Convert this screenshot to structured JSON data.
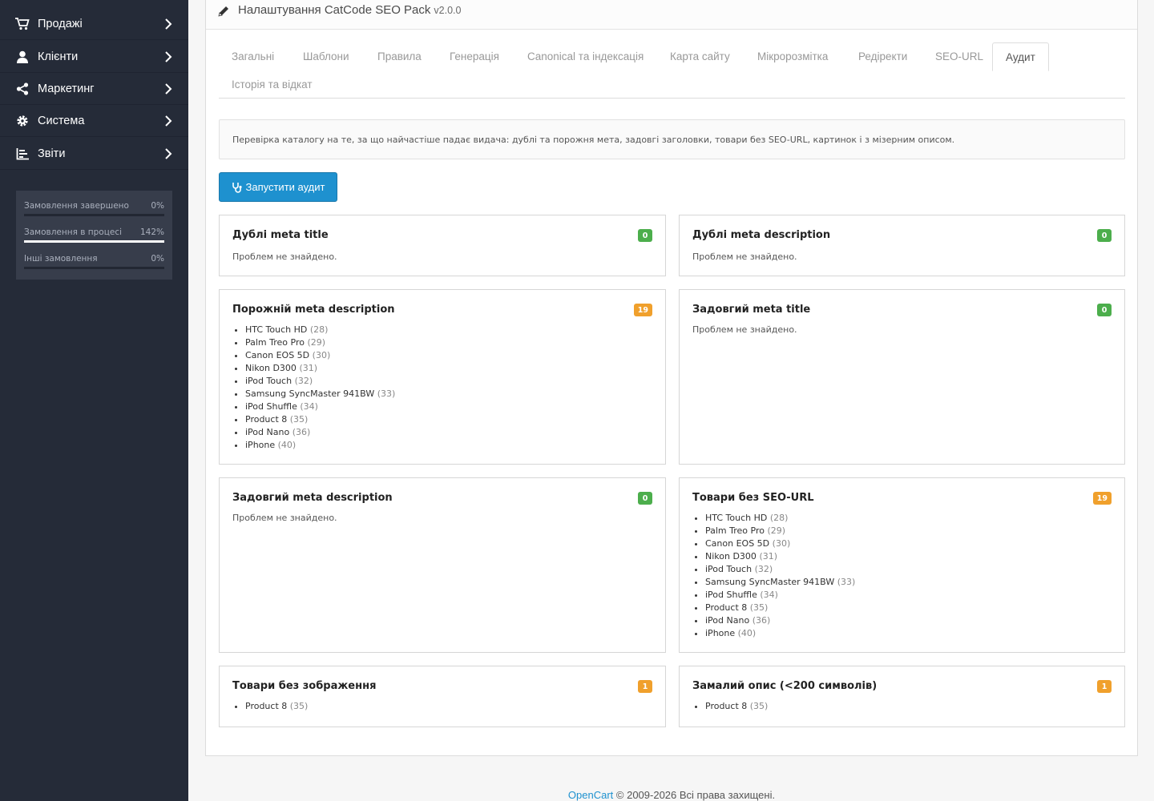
{
  "sidebar": {
    "items": [
      {
        "label": "Продажі",
        "icon": "cart-icon"
      },
      {
        "label": "Клієнти",
        "icon": "user-icon"
      },
      {
        "label": "Маркетинг",
        "icon": "share-icon"
      },
      {
        "label": "Система",
        "icon": "gear-icon"
      },
      {
        "label": "Звіти",
        "icon": "bar-chart-icon"
      }
    ],
    "stats": [
      {
        "label": "Замовлення завершено",
        "value": "0%",
        "fill": 0
      },
      {
        "label": "Замовлення в процесі",
        "value": "142%",
        "fill": 1
      },
      {
        "label": "Інші замовлення",
        "value": "0%",
        "fill": 0
      }
    ]
  },
  "header": {
    "title": "Налаштування CatCode SEO Pack",
    "version": "v2.0.0"
  },
  "tabs": [
    "Загальні",
    "Шаблони",
    "Правила",
    "Генерація",
    "Canonical та індексація",
    "Карта сайту",
    "Мікророзмітка",
    "Редіректи",
    "SEO-URL",
    "Аудит",
    "Історія та відкат"
  ],
  "info": "Перевірка каталогу на те, за що найчастіше падає видача: дублі та порожня мета, задовгі заголовки, товари без SEO-URL, картинок і з мізерним описом.",
  "run_button": "Запустити аудит",
  "empty_text": "Проблем не знайдено.",
  "cards": [
    {
      "title": "Дублі meta title",
      "count": "0",
      "status": "green",
      "items": []
    },
    {
      "title": "Дублі meta description",
      "count": "0",
      "status": "green",
      "items": []
    },
    {
      "title": "Порожній meta description",
      "count": "19",
      "status": "orange",
      "items": [
        {
          "name": "HTC Touch HD",
          "id": "(28)"
        },
        {
          "name": "Palm Treo Pro",
          "id": "(29)"
        },
        {
          "name": "Canon EOS 5D",
          "id": "(30)"
        },
        {
          "name": "Nikon D300",
          "id": "(31)"
        },
        {
          "name": "iPod Touch",
          "id": "(32)"
        },
        {
          "name": "Samsung SyncMaster 941BW",
          "id": "(33)"
        },
        {
          "name": "iPod Shuffle",
          "id": "(34)"
        },
        {
          "name": "Product 8",
          "id": "(35)"
        },
        {
          "name": "iPod Nano",
          "id": "(36)"
        },
        {
          "name": "iPhone",
          "id": "(40)"
        }
      ]
    },
    {
      "title": "Задовгий meta title",
      "count": "0",
      "status": "green",
      "items": []
    },
    {
      "title": "Задовгий meta description",
      "count": "0",
      "status": "green",
      "items": []
    },
    {
      "title": "Товари без SEO-URL",
      "count": "19",
      "status": "orange",
      "items": [
        {
          "name": "HTC Touch HD",
          "id": "(28)"
        },
        {
          "name": "Palm Treo Pro",
          "id": "(29)"
        },
        {
          "name": "Canon EOS 5D",
          "id": "(30)"
        },
        {
          "name": "Nikon D300",
          "id": "(31)"
        },
        {
          "name": "iPod Touch",
          "id": "(32)"
        },
        {
          "name": "Samsung SyncMaster 941BW",
          "id": "(33)"
        },
        {
          "name": "iPod Shuffle",
          "id": "(34)"
        },
        {
          "name": "Product 8",
          "id": "(35)"
        },
        {
          "name": "iPod Nano",
          "id": "(36)"
        },
        {
          "name": "iPhone",
          "id": "(40)"
        }
      ]
    },
    {
      "title": "Товари без зображення",
      "count": "1",
      "status": "orange",
      "items": [
        {
          "name": "Product 8",
          "id": "(35)"
        }
      ]
    },
    {
      "title": "Замалий опис (<200 символів)",
      "count": "1",
      "status": "orange",
      "items": [
        {
          "name": "Product 8",
          "id": "(35)"
        }
      ]
    }
  ],
  "footer": {
    "link": "OpenCart",
    "text": " © 2009-2026 Всі права захищені."
  },
  "colors": {
    "sidebar": "#252b38",
    "primary": "#1e91cf",
    "success": "#4cae4c",
    "warning": "#f0a02c"
  }
}
